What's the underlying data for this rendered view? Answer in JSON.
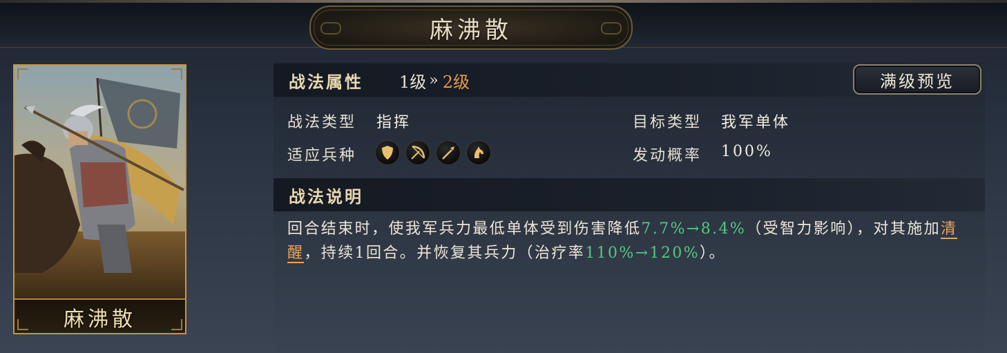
{
  "header": {
    "title": "麻沸散"
  },
  "card": {
    "name": "麻沸散"
  },
  "attributes": {
    "section_title": "战法属性",
    "level_from": "1级",
    "level_arrow": "»",
    "level_to": "2级",
    "preview_button": "满级预览",
    "type_label": "战法类型",
    "type_value": "指挥",
    "target_label": "目标类型",
    "target_value": "我军单体",
    "troop_label": "适应兵种",
    "troop_icons": [
      "shield-icon",
      "bow-icon",
      "spear-icon",
      "horse-icon"
    ],
    "chance_label": "发动概率",
    "chance_value": "100%"
  },
  "description": {
    "section_title": "战法说明",
    "text_1": "回合结束时，使我军兵力最低单体受到伤害降低",
    "damage_reduction": "7.7%→8.4%",
    "text_2": "（受智力影响），对其施加",
    "keyword": "清醒",
    "text_3": "，持续1回合。并恢复其兵力（治疗率",
    "heal_rate": "110%→120%",
    "text_4": "）。"
  },
  "colors": {
    "accent_gold": "#c9963a",
    "level_highlight": "#e89a4a",
    "value_green": "#56c884",
    "keyword_orange": "#e8a65a"
  }
}
